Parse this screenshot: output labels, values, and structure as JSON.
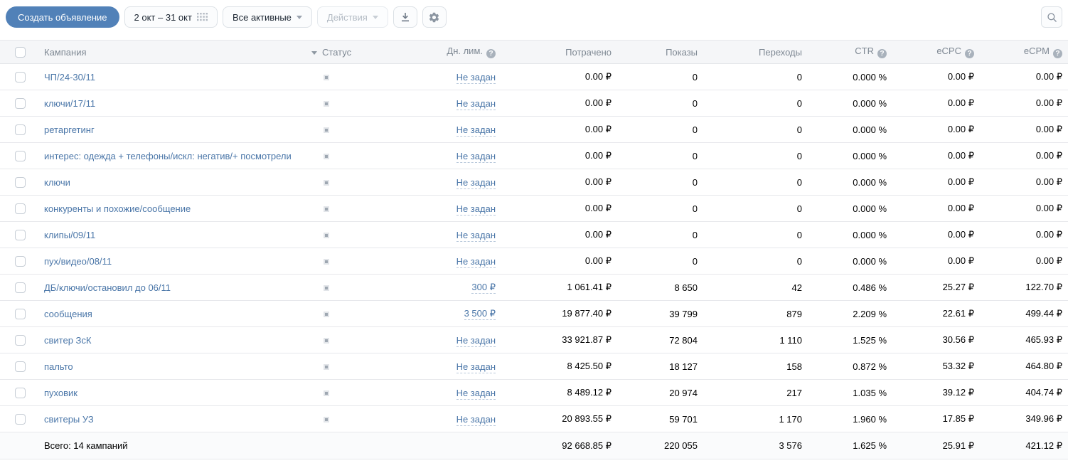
{
  "toolbar": {
    "create_button": "Создать объявление",
    "date_range": "2 окт – 31 окт",
    "status_filter": "Все активные",
    "actions": "Действия"
  },
  "icons": {
    "info_glyph": "?"
  },
  "table": {
    "header": {
      "campaign": "Кампания",
      "status": "Статус",
      "daily_limit": "Дн. лим.",
      "spent": "Потрачено",
      "impressions": "Показы",
      "clicks": "Переходы",
      "ctr": "CTR",
      "ecpc": "eCPC",
      "ecpm": "eCPM"
    },
    "rows": [
      {
        "name": "ЧП/24-30/11",
        "status": "stopped",
        "limit": "Не задан",
        "spent": "0.00 ₽",
        "impressions": "0",
        "clicks": "0",
        "ctr": "0.000 %",
        "ecpc": "0.00 ₽",
        "ecpm": "0.00 ₽"
      },
      {
        "name": "ключи/17/11",
        "status": "stopped",
        "limit": "Не задан",
        "spent": "0.00 ₽",
        "impressions": "0",
        "clicks": "0",
        "ctr": "0.000 %",
        "ecpc": "0.00 ₽",
        "ecpm": "0.00 ₽"
      },
      {
        "name": "ретаргетинг",
        "status": "stopped",
        "limit": "Не задан",
        "spent": "0.00 ₽",
        "impressions": "0",
        "clicks": "0",
        "ctr": "0.000 %",
        "ecpc": "0.00 ₽",
        "ecpm": "0.00 ₽"
      },
      {
        "name": "интерес: одежда + телефоны/искл: негатив/+ посмотрели",
        "status": "stopped",
        "limit": "Не задан",
        "spent": "0.00 ₽",
        "impressions": "0",
        "clicks": "0",
        "ctr": "0.000 %",
        "ecpc": "0.00 ₽",
        "ecpm": "0.00 ₽"
      },
      {
        "name": "ключи",
        "status": "stopped",
        "limit": "Не задан",
        "spent": "0.00 ₽",
        "impressions": "0",
        "clicks": "0",
        "ctr": "0.000 %",
        "ecpc": "0.00 ₽",
        "ecpm": "0.00 ₽"
      },
      {
        "name": "конкуренты и похожие/сообщение",
        "status": "stopped",
        "limit": "Не задан",
        "spent": "0.00 ₽",
        "impressions": "0",
        "clicks": "0",
        "ctr": "0.000 %",
        "ecpc": "0.00 ₽",
        "ecpm": "0.00 ₽"
      },
      {
        "name": "клипы/09/11",
        "status": "stopped",
        "limit": "Не задан",
        "spent": "0.00 ₽",
        "impressions": "0",
        "clicks": "0",
        "ctr": "0.000 %",
        "ecpc": "0.00 ₽",
        "ecpm": "0.00 ₽"
      },
      {
        "name": "пух/видео/08/11",
        "status": "stopped",
        "limit": "Не задан",
        "spent": "0.00 ₽",
        "impressions": "0",
        "clicks": "0",
        "ctr": "0.000 %",
        "ecpc": "0.00 ₽",
        "ecpm": "0.00 ₽"
      },
      {
        "name": "ДБ/ключи/остановил до 06/11",
        "status": "stopped",
        "limit": "300 ₽",
        "spent": "1 061.41 ₽",
        "impressions": "8 650",
        "clicks": "42",
        "ctr": "0.486 %",
        "ecpc": "25.27 ₽",
        "ecpm": "122.70 ₽"
      },
      {
        "name": "сообщения",
        "status": "stopped",
        "limit": "3 500 ₽",
        "spent": "19 877.40 ₽",
        "impressions": "39 799",
        "clicks": "879",
        "ctr": "2.209 %",
        "ecpc": "22.61 ₽",
        "ecpm": "499.44 ₽"
      },
      {
        "name": "свитер ЗсК",
        "status": "stopped",
        "limit": "Не задан",
        "spent": "33 921.87 ₽",
        "impressions": "72 804",
        "clicks": "1 110",
        "ctr": "1.525 %",
        "ecpc": "30.56 ₽",
        "ecpm": "465.93 ₽"
      },
      {
        "name": "пальто",
        "status": "stopped",
        "limit": "Не задан",
        "spent": "8 425.50 ₽",
        "impressions": "18 127",
        "clicks": "158",
        "ctr": "0.872 %",
        "ecpc": "53.32 ₽",
        "ecpm": "464.80 ₽"
      },
      {
        "name": "пуховик",
        "status": "stopped",
        "limit": "Не задан",
        "spent": "8 489.12 ₽",
        "impressions": "20 974",
        "clicks": "217",
        "ctr": "1.035 %",
        "ecpc": "39.12 ₽",
        "ecpm": "404.74 ₽"
      },
      {
        "name": "свитеры УЗ",
        "status": "stopped",
        "limit": "Не задан",
        "spent": "20 893.55 ₽",
        "impressions": "59 701",
        "clicks": "1 170",
        "ctr": "1.960 %",
        "ecpc": "17.85 ₽",
        "ecpm": "349.96 ₽"
      }
    ],
    "total": {
      "label": "Всего: 14 кампаний",
      "spent": "92 668.85 ₽",
      "impressions": "220 055",
      "clicks": "3 576",
      "ctr": "1.625 %",
      "ecpc": "25.91 ₽",
      "ecpm": "421.12 ₽"
    }
  },
  "colors": {
    "accent": "#5181b8",
    "link": "#4a76a8",
    "header_text": "#7e8893",
    "row_border": "#e7e8ec",
    "status_icon": "#9ea7b1"
  }
}
